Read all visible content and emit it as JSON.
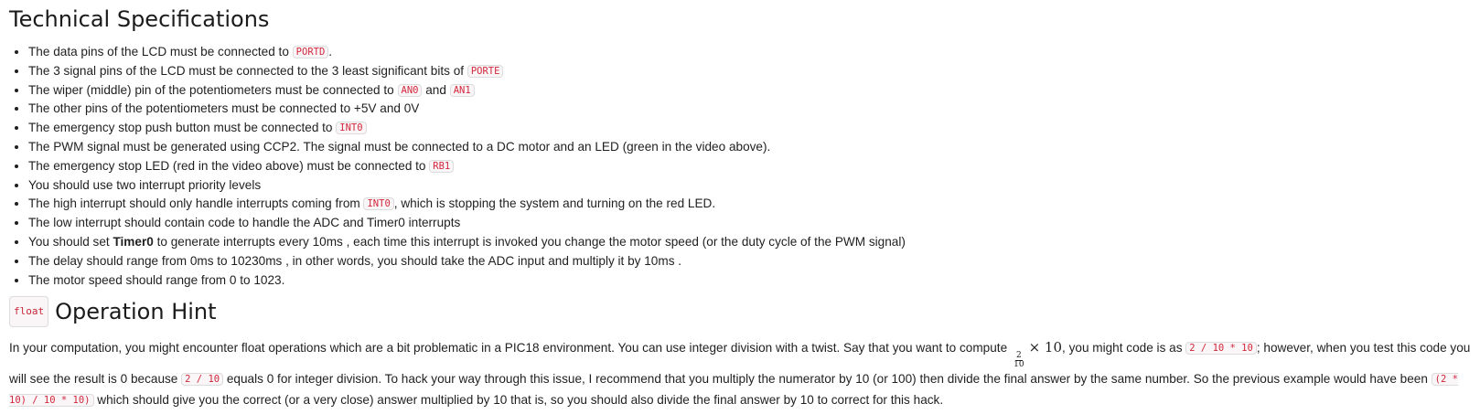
{
  "section1": {
    "title": "Technical Specifications",
    "items": {
      "i1": {
        "text": "The data pins of the LCD must be connected to ",
        "code": "PORTD",
        "after": "."
      },
      "i2": {
        "text": "The 3 signal pins of the LCD must be connected to the 3 least significant bits of ",
        "code": "PORTE"
      },
      "i3": {
        "text": "The wiper (middle) pin of the potentiometers must be connected to ",
        "code1": "AN0",
        "mid": " and ",
        "code2": "AN1"
      },
      "i4": {
        "text": "The other pins of the potentiometers must be connected to +5V and 0V"
      },
      "i5": {
        "text": "The emergency stop push button must be connected to ",
        "code": "INT0"
      },
      "i6": {
        "text": "The PWM signal must be generated using CCP2. The signal must be connected to a DC motor and an LED (green in the video above)."
      },
      "i7": {
        "text": "The emergency stop LED (red in the video above) must be connected to ",
        "code": "RB1"
      },
      "i8": {
        "text": "You should use two interrupt priority levels"
      },
      "i9": {
        "text": "The high interrupt should only handle interrupts coming from ",
        "code": "INT0",
        "after": ", which is stopping the system and turning on the red LED."
      },
      "i10": {
        "text": "The low interrupt should contain code to handle the ADC and Timer0 interrupts"
      },
      "i11": {
        "before": "You should set ",
        "bold": "Timer0",
        "after": " to generate interrupts every 10ms , each time this interrupt is invoked you change the motor speed (or the duty cycle of the PWM signal)"
      },
      "i12": {
        "text": "The delay should range from 0ms to 10230ms , in other words, you should take the ADC input and multiply it by 10ms ."
      },
      "i13": {
        "text": "The motor speed should range from 0 to 1023."
      }
    }
  },
  "section2": {
    "badge": "float",
    "title": "Operation Hint",
    "p1": "In your computation, you might encounter float operations which are a bit problematic in a PIC18 environment. You can use integer division with a twist. Say that you want to compute",
    "frac_num": "2",
    "frac_den": "10",
    "math_rest": "× 10",
    "p2": ", you might code is as ",
    "code1": "2 / 10 * 10",
    "p3": "; however, when you test this code you will see the result is 0 because ",
    "code2": "2 / 10",
    "p4": " equals 0 for integer division. To hack your way through this issue, I recommend that you multiply the numerator by 10 (or 100) then divide the final answer by the same number. So the previous example would have been ",
    "code3": "(2 * 10) / 10 * 10)",
    "p5": " which should give you the correct (or a very close) answer multiplied by 10 that is, so you should also divide the final answer by 10 to correct for this hack."
  }
}
